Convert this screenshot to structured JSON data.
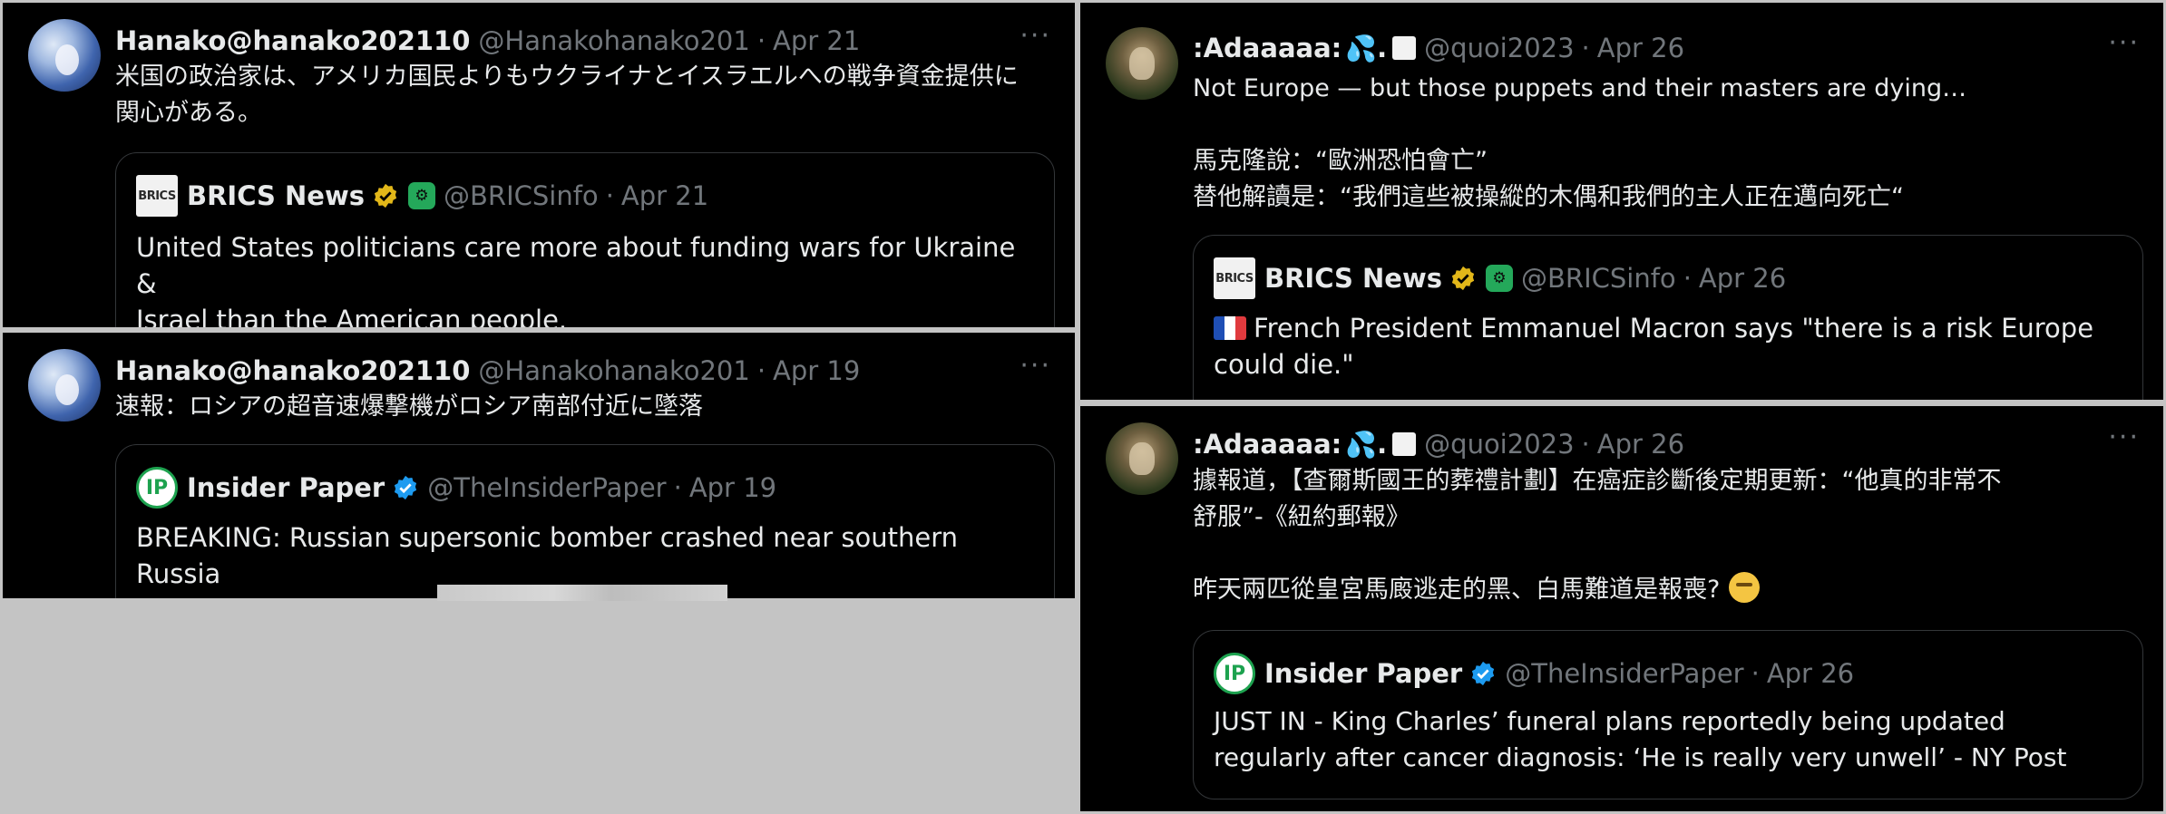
{
  "posts": [
    {
      "name": "Hanako@hanako202110",
      "handle": "@Hanakohanako201",
      "date": "Apr 21",
      "text": "米国の政治家は、アメリカ国民よりもウクライナとイスラエルへの戦争資金提供に\n関心がある。",
      "quote": {
        "name": "BRICS News",
        "handle": "@BRICSinfo",
        "date": "Apr 21",
        "logo": "BRICS",
        "text": "United States politicians care more about funding wars for Ukraine &\nIsrael than the American people."
      }
    },
    {
      "name": "Hanako@hanako202110",
      "handle": "@Hanakohanako201",
      "date": "Apr 19",
      "text": "速報：ロシアの超音速爆撃機がロシア南部付近に墜落",
      "quote": {
        "name": "Insider Paper",
        "handle": "@TheInsiderPaper",
        "date": "Apr 19",
        "logo": "IP",
        "text": "BREAKING: Russian supersonic bomber crashed near southern Russia"
      }
    },
    {
      "name": ":Adaaaaa:",
      "handle": "@quoi2023",
      "date": "Apr 26",
      "text": "Not Europe — but those puppets and their masters are dying…\n\n馬克隆說：“歐洲恐怕會亡”\n替他解讀是：“我們這些被操縱的木偶和我們的主人正在邁向死亡“",
      "quote": {
        "name": "BRICS News",
        "handle": "@BRICSinfo",
        "date": "Apr 26",
        "logo": "BRICS",
        "text": "French President Emmanuel Macron says \"there is a risk Europe\ncould die.\""
      }
    },
    {
      "name": ":Adaaaaa:",
      "handle": "@quoi2023",
      "date": "Apr 26",
      "text": "據報道，【查爾斯國王的葬禮計劃】在癌症診斷後定期更新：“他真的非常不\n舒服”-《紐約郵報》\n\n昨天兩匹從皇宮馬廄逃走的黑、白馬難道是報喪?",
      "quote": {
        "name": "Insider Paper",
        "handle": "@TheInsiderPaper",
        "date": "Apr 26",
        "logo": "IP",
        "text": "JUST IN - King Charles’ funeral plans reportedly being updated\nregularly after cancer diagnosis: ‘He is really very unwell’ - NY Post"
      }
    }
  ],
  "ui": {
    "dot": "·",
    "more": "···"
  },
  "icons": {
    "more": "more-options-icon",
    "gold_badge": "gold-verified-badge-icon",
    "blue_badge": "blue-verified-badge-icon",
    "bot": "automated-account-icon",
    "flag": "france-flag-icon",
    "drop": "sweat-droplets-icon",
    "thinking": "thinking-face-icon"
  },
  "colors": {
    "background": "#000000",
    "text": "#e7e9ea",
    "muted": "#71767b",
    "border": "#333639",
    "gold": "#e2b719",
    "blue": "#1d9bf0",
    "bot": "#24a85a"
  }
}
